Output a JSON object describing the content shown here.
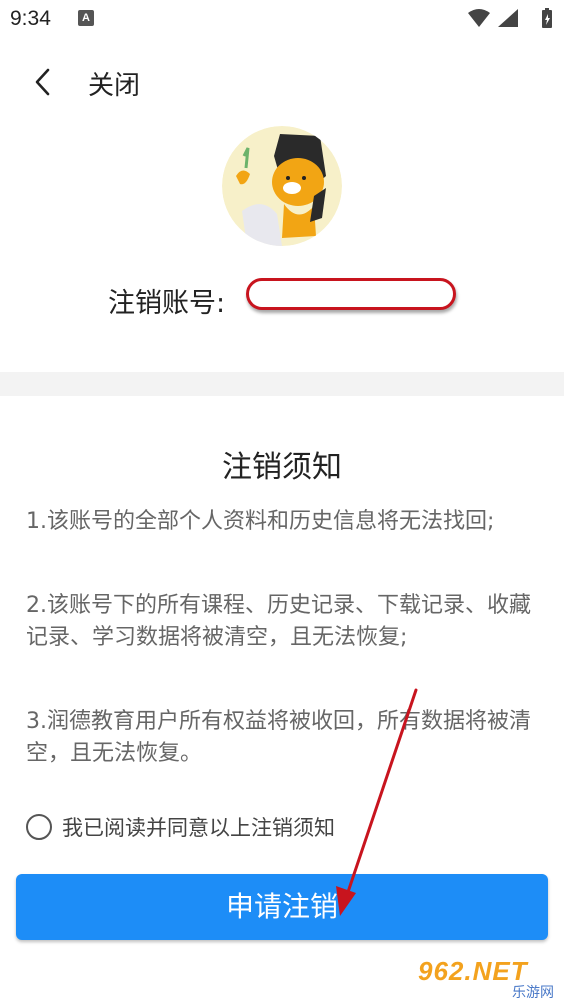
{
  "status_bar": {
    "time": "9:34",
    "notification_badge": "A",
    "icons": [
      "wifi-icon",
      "signal-icon",
      "battery-icon"
    ]
  },
  "header": {
    "back_icon": "chevron-left-icon",
    "close_label": "关闭"
  },
  "account": {
    "label": "注销账号:",
    "value": ""
  },
  "notice": {
    "title": "注销须知",
    "items": [
      "1.该账号的全部个人资料和历史信息将无法找回;",
      "2.该账号下的所有课程、历史记录、下载记录、收藏记录、学习数据将被清空，且无法恢复;",
      "3.润德教育用户所有权益将被收回，所有数据将被清空，且无法恢复。"
    ]
  },
  "agreement": {
    "label": "我已阅读并同意以上注销须知",
    "checked": false
  },
  "apply_button": {
    "label": "申请注销"
  },
  "watermark": {
    "text": "962.NET",
    "sub": "乐游网"
  },
  "colors": {
    "primary_button": "#1d8df7",
    "annotation": "#c8141e",
    "divider": "#f3f3f3"
  }
}
